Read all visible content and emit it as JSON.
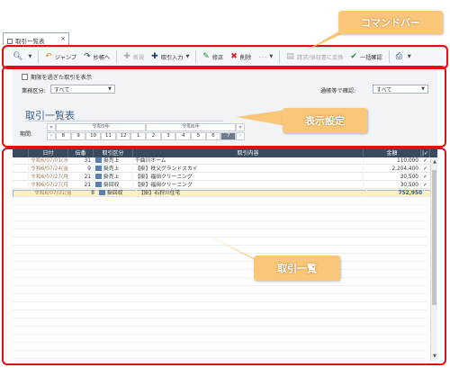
{
  "tab": {
    "label": "取引一覧表"
  },
  "toolbar": {
    "items": [
      {
        "label": "ジャンプ",
        "icon": "back-arrow-icon",
        "enabled": true,
        "dropdown": false
      },
      {
        "label": "抄帳へ",
        "icon": "forward-arrow-icon",
        "enabled": true,
        "dropdown": false
      },
      {
        "label": "新規",
        "icon": "plus-icon",
        "enabled": false,
        "dropdown": false
      },
      {
        "label": "取引入力",
        "icon": "plus-icon",
        "enabled": true,
        "dropdown": true
      },
      {
        "label": "修正",
        "icon": "pencil-icon",
        "enabled": true,
        "dropdown": false
      },
      {
        "label": "削除",
        "icon": "x-icon",
        "enabled": true,
        "dropdown": false
      },
      {
        "label": "･･･",
        "icon": "",
        "enabled": false,
        "dropdown": true
      },
      {
        "label": "請求/領収書に変換",
        "icon": "document-icon",
        "enabled": false,
        "dropdown": false
      },
      {
        "label": "一括確認",
        "icon": "check-icon",
        "enabled": true,
        "dropdown": false
      }
    ]
  },
  "callouts": {
    "commandbar": "コマンドバー",
    "display_settings": "表示設定",
    "transaction_list": "取引一覧"
  },
  "filter": {
    "show_expired_label": "期限を過ぎた取引を表示",
    "business_category_label": "業務区分:",
    "business_category_value": "すべて",
    "bank_confirm_label": "通帳等で確認:",
    "bank_confirm_value": "すべて",
    "list_title": "取引一覧表",
    "period_label": "期間:",
    "year_prev": "令和5年",
    "year_next": "令和6年",
    "months": [
      "8",
      "9",
      "10",
      "11",
      "12",
      "1",
      "2",
      "3",
      "4",
      "5",
      "6",
      "7"
    ],
    "active_month": "7"
  },
  "table": {
    "columns": [
      "日付",
      "伝番",
      "取引区分",
      "取引内容",
      "金額",
      "|✓"
    ],
    "rows": [
      {
        "date": "令和6/07/01(水)",
        "no": "31",
        "kind": "掛売上",
        "content": "千曲川ホーム",
        "amount": "110,000",
        "mark": "✓"
      },
      {
        "date": "令和6/07/24(金)",
        "no": "9",
        "kind": "掛売上",
        "content": "【掛】秩父グランドスカイ",
        "amount": "2,204,400",
        "mark": "✓"
      },
      {
        "date": "令和6/07/27(月)",
        "no": "21",
        "kind": "掛売上",
        "content": "【掛】福田クリーニング",
        "amount": "30,500",
        "mark": "✓"
      },
      {
        "date": "令和6/07/27(月)",
        "no": "21",
        "kind": "掛回収",
        "content": "【掛】福田クリーニング",
        "amount": "30,500",
        "mark": "✓"
      },
      {
        "date": "令和6/07/31(金)",
        "no": "8",
        "kind": "掛回収",
        "content": "【掛】石狩川住宅",
        "amount": "752,950",
        "mark": ""
      }
    ]
  }
}
